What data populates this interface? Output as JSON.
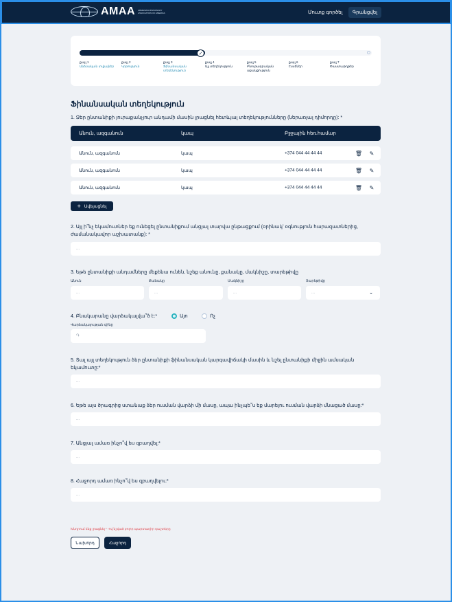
{
  "header": {
    "logo_text": "AMAA",
    "logo_subtitle": "ARMENIAN MISSIONARY ASSOCIATION OF AMERICA",
    "login": "Մուտք գործել",
    "register": "Գրանցվել"
  },
  "progress": {
    "fill_fraction": 0.43,
    "steps": [
      {
        "num": "քայլ 1",
        "label": "Անձնական տվյալներ"
      },
      {
        "num": "քայլ 2",
        "label": "Կրթություն"
      },
      {
        "num": "քայլ 3",
        "label": "Ֆինանսական տեղեկություն"
      },
      {
        "num": "քայլ 4",
        "label": "Այլ տեղեկություն"
      },
      {
        "num": "քայլ 5",
        "label": "Բնութագրական աջակցություն"
      },
      {
        "num": "քայլ 6",
        "label": "Էսսեներ"
      },
      {
        "num": "քայլ 7",
        "label": "Փաստաթղթեր"
      }
    ]
  },
  "page_title": "Ֆինանսական տեղեկություն",
  "q1": {
    "text": "1. Ձեր ընտանիքի յուրաքանչյուր անդամի մասին լրացնել հետևյալ տեղեկությունները (ներառյալ դիմորդը): *",
    "columns": [
      "Անուն, ազգանուն",
      "կապ",
      "Բջջային հեռ.համար"
    ],
    "rows": [
      [
        "Անուն, ազգանուն",
        "կապ",
        "+374 044 44 44 44"
      ],
      [
        "Անուն, ազգանուն",
        "կապ",
        "+374 044 44 44 44"
      ],
      [
        "Անուն, ազգանուն",
        "կապ",
        "+374 044 44 44 44"
      ]
    ],
    "add_label": "Ավելացնել"
  },
  "q2": {
    "text": "2. Այլ ի՞նչ եկամուտներ եք ունեցել ընտանիքում անցյալ տարվա ընթացքում (օրինակ՝ օգնություն հարազատներից, ժամանակավոր աշխատանք): *",
    "placeholder": "..."
  },
  "q3": {
    "text": "3. Եթե ընտանիքի անդամները մեքենա ունեն, նշեք անունը, քանակը, մակնիշը, տարեթիվը",
    "fields": [
      {
        "label": "Անուն",
        "placeholder": "..."
      },
      {
        "label": "Քանակը",
        "placeholder": "..."
      },
      {
        "label": "Մակնիշը",
        "placeholder": "..."
      },
      {
        "label": "Տարեթիվը",
        "placeholder": "..."
      }
    ]
  },
  "q4": {
    "text": "4. Բնակարանը վարձակալվա՞ծ է:*",
    "yes": "Այո",
    "no": "Ոչ",
    "selected": "yes",
    "rent_label": "Վարձակալության գինը",
    "rent_placeholder": "֏"
  },
  "q5": {
    "text": "5. Տալ այլ տեղեկություն ձեր ընտանիքի ֆինանսական կարգավիճակի մասին և նշել ընտանիքի միջին ամսական եկամուտը:*",
    "placeholder": "..."
  },
  "q6": {
    "text": "6. Եթե այս ծրագրից ստանաք ձեր ուսման վարձի մի մասը, ապա ինչպե՞ս եք մարելու ուսման վարձի մնացած մասը:*",
    "placeholder": "..."
  },
  "q7": {
    "text": "7. Անցյալ ամառ ինչո՞վ ես զբաղվել:*",
    "placeholder": "..."
  },
  "q8": {
    "text": "8. Հաջորդ ամառ ինչո՞վ ես զբաղվելու:*",
    "placeholder": "..."
  },
  "required_note": "Խնդրում ենք լրացնել * -ով նշված բոլոր պարտադիր դաշտերը",
  "buttons": {
    "prev": "Նախորդ",
    "next": "Հաջորդ"
  }
}
